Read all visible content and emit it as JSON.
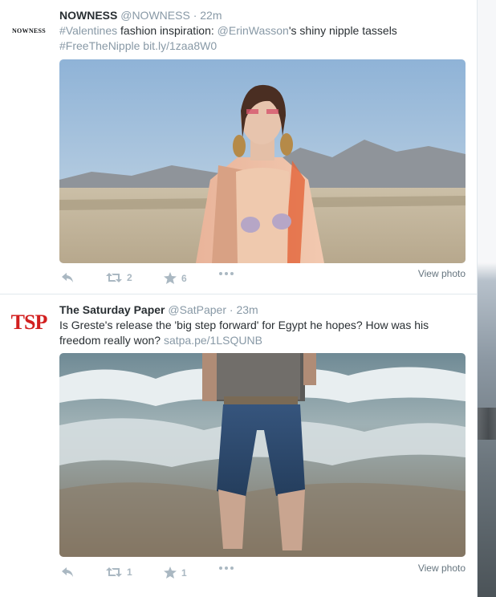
{
  "tweets": [
    {
      "avatar_text": "NOWNESS",
      "fullname": "NOWNESS",
      "username": "@NOWNESS",
      "dot": "·",
      "time": "22m",
      "text": {
        "hashtag1": "#Valentines",
        "part1": " fashion inspiration: ",
        "mention": "@ErinWasson",
        "part2": "'s shiny nipple tassels",
        "hashtag2": "#FreeTheNipple",
        "url": "bit.ly/1zaa8W0"
      },
      "actions": {
        "retweets": "2",
        "favorites": "6"
      },
      "view_photo": "View photo"
    },
    {
      "avatar_text": "TSP",
      "fullname": "The Saturday Paper",
      "username": "@SatPaper",
      "dot": "·",
      "time": "23m",
      "text": {
        "part1": "Is Greste's release the 'big step forward' for Egypt he hopes? How was his freedom really won? ",
        "url": "satpa.pe/1LSQUNB"
      },
      "actions": {
        "retweets": "1",
        "favorites": "1"
      },
      "view_photo": "View photo"
    }
  ],
  "colors": {
    "link": "#8899a6",
    "action_icon": "#aab8c2",
    "tsp_red": "#d21f1f"
  },
  "icons": [
    "reply-icon",
    "retweet-icon",
    "favorite-star-icon",
    "more-icon"
  ]
}
